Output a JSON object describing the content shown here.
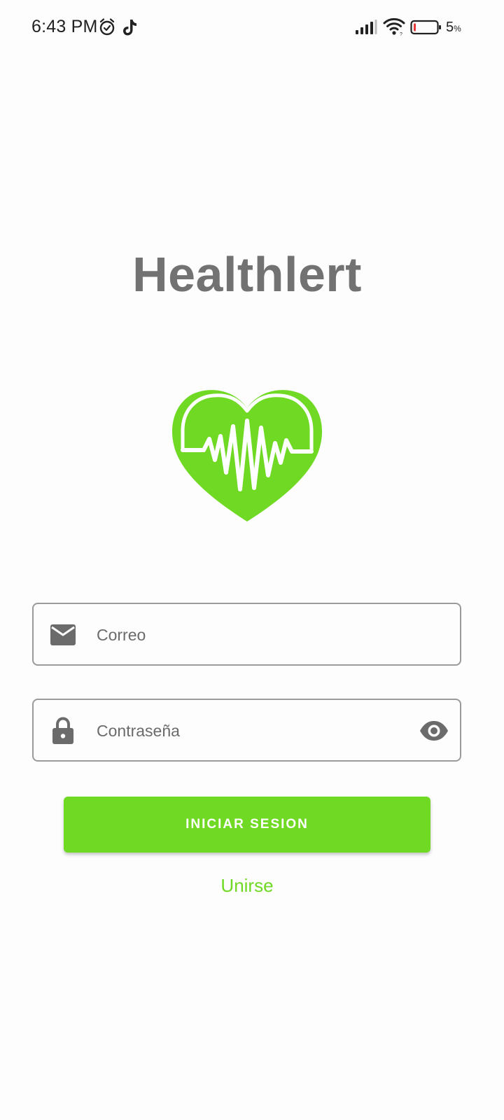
{
  "status_bar": {
    "time": "6:43 PM",
    "icons": [
      "alarm-icon",
      "tiktok-icon",
      "signal-icon",
      "wifi-icon",
      "battery-icon"
    ],
    "battery_percent": "5",
    "battery_percent_sign": "%"
  },
  "app": {
    "title": "Healthlert",
    "logo": "heart-pulse-logo"
  },
  "form": {
    "email": {
      "placeholder": "Correo",
      "value": "",
      "icon": "email-icon"
    },
    "password": {
      "placeholder": "Contraseña",
      "value": "",
      "icon": "lock-icon",
      "toggle_icon": "eye-icon"
    },
    "login_label": "INICIAR SESION",
    "join_label": "Unirse"
  },
  "colors": {
    "accent": "#6fd924",
    "title_text": "#727272",
    "icon_gray": "#6b6b6b",
    "field_border": "#9a9a9a",
    "background": "#fdfdfd"
  }
}
